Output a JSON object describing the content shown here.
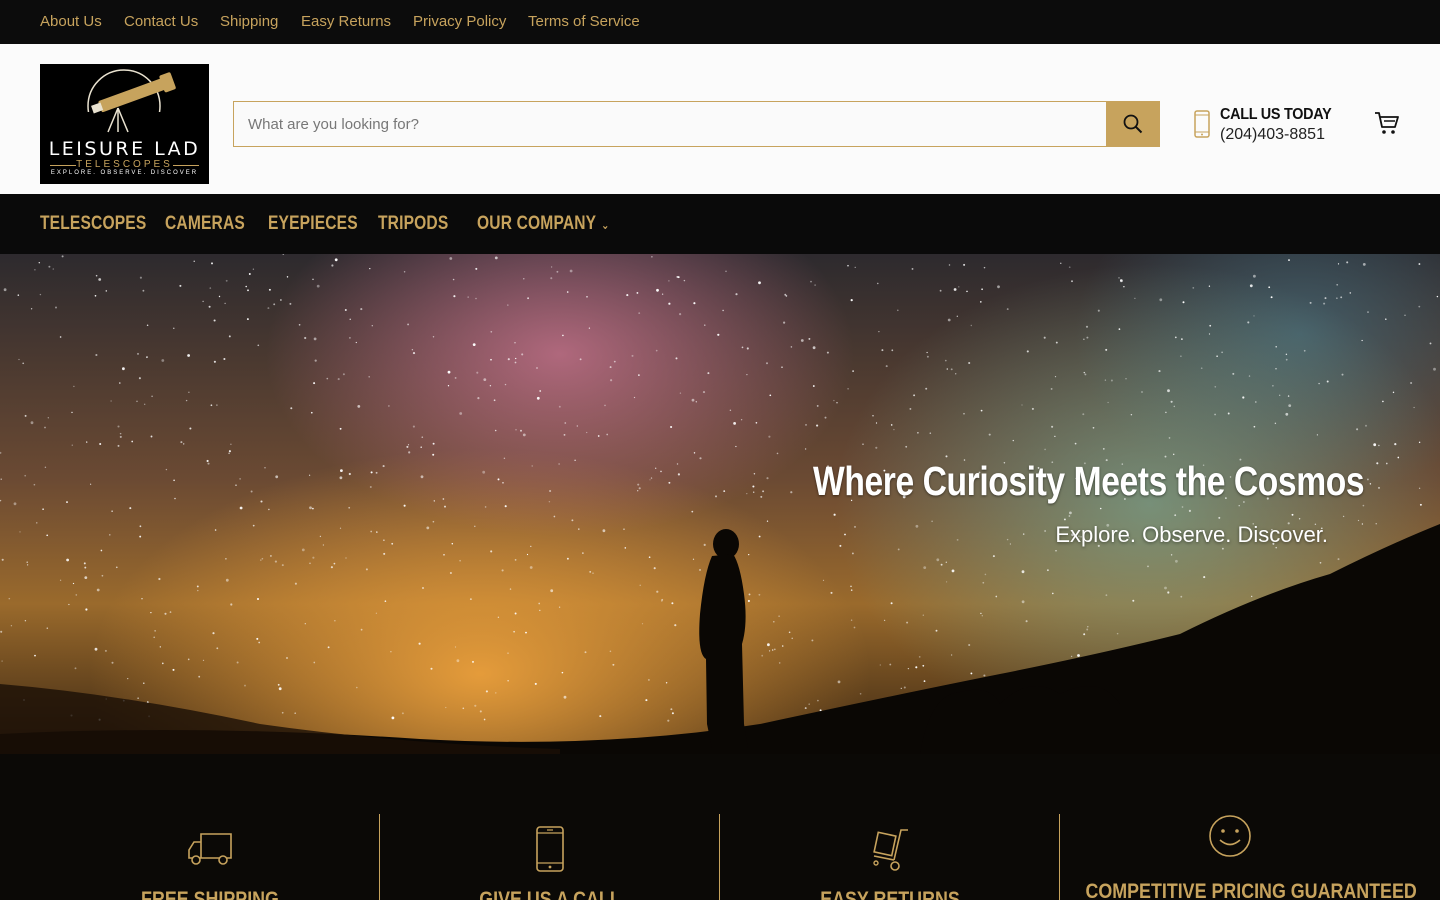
{
  "topbar": {
    "links": [
      {
        "label": "About Us"
      },
      {
        "label": "Contact Us"
      },
      {
        "label": "Shipping"
      },
      {
        "label": "Easy Returns"
      },
      {
        "label": "Privacy Policy"
      },
      {
        "label": "Terms of Service"
      }
    ]
  },
  "header": {
    "logo": {
      "name": "LEISURE LAD",
      "sub": "TELESCOPES",
      "tagline": "EXPLORE. OBSERVE. DISCOVER"
    },
    "search": {
      "placeholder": "What are you looking for?",
      "value": "",
      "button_icon": "search-icon"
    },
    "call": {
      "title": "CALL US TODAY",
      "phone": "(204)403-8851",
      "icon": "phone-icon"
    },
    "cart_icon": "cart-icon"
  },
  "nav": {
    "items": [
      {
        "label": "TELESCOPES"
      },
      {
        "label": "CAMERAS"
      },
      {
        "label": "EYEPIECES"
      },
      {
        "label": "TRIPODS"
      },
      {
        "label": "OUR COMPANY",
        "has_dropdown": true
      }
    ]
  },
  "hero": {
    "title": "Where Curiosity Meets the Cosmos",
    "subtitle": "Explore. Observe. Discover."
  },
  "features": [
    {
      "icon": "truck-icon",
      "label": "FREE SHIPPING"
    },
    {
      "icon": "phone-icon",
      "label": "GIVE US A CALL"
    },
    {
      "icon": "dolly-icon",
      "label": "EASY RETURNS"
    },
    {
      "icon": "smiley-icon",
      "label": "COMPETITIVE PRICING GUARANTEED"
    }
  ],
  "colors": {
    "accent": "#c7a35d",
    "dark": "#0a0a0a",
    "header_bg": "#fbfbfb"
  }
}
